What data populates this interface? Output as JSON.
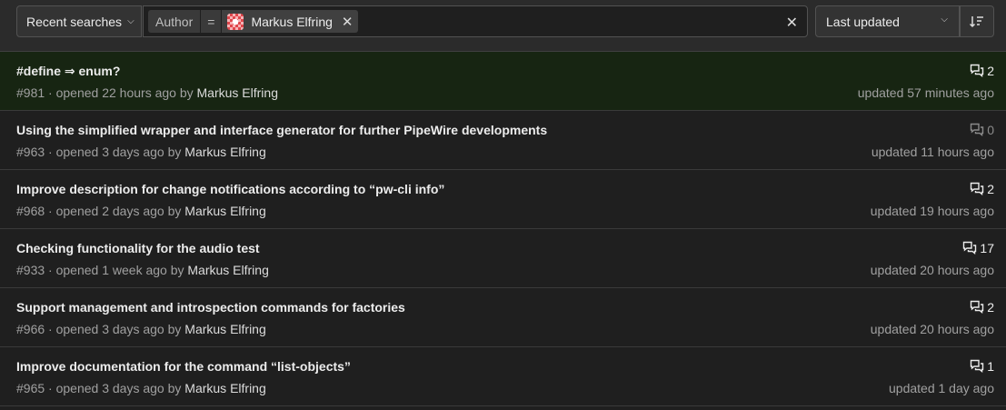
{
  "filter": {
    "recent_label": "Recent searches",
    "token_field": "Author",
    "token_operator": "=",
    "token_value": "Markus Elfring",
    "sort_label": "Last updated"
  },
  "issues": [
    {
      "title": "#define ⇒ enum?",
      "number": "#981",
      "opened": "opened 22 hours ago by",
      "author": "Markus Elfring",
      "comments": "2",
      "updated": "updated 57 minutes ago"
    },
    {
      "title": "Using the simplified wrapper and interface generator for further PipeWire developments",
      "number": "#963",
      "opened": "opened 3 days ago by",
      "author": "Markus Elfring",
      "comments": "0",
      "updated": "updated 11 hours ago"
    },
    {
      "title": "Improve description for change notifications according to “pw-cli info”",
      "number": "#968",
      "opened": "opened 2 days ago by",
      "author": "Markus Elfring",
      "comments": "2",
      "updated": "updated 19 hours ago"
    },
    {
      "title": "Checking functionality for the audio test",
      "number": "#933",
      "opened": "opened 1 week ago by",
      "author": "Markus Elfring",
      "comments": "17",
      "updated": "updated 20 hours ago"
    },
    {
      "title": "Support management and introspection commands for factories",
      "number": "#966",
      "opened": "opened 3 days ago by",
      "author": "Markus Elfring",
      "comments": "2",
      "updated": "updated 20 hours ago"
    },
    {
      "title": "Improve documentation for the command “list-objects”",
      "number": "#965",
      "opened": "opened 3 days ago by",
      "author": "Markus Elfring",
      "comments": "1",
      "updated": "updated 1 day ago"
    }
  ]
}
